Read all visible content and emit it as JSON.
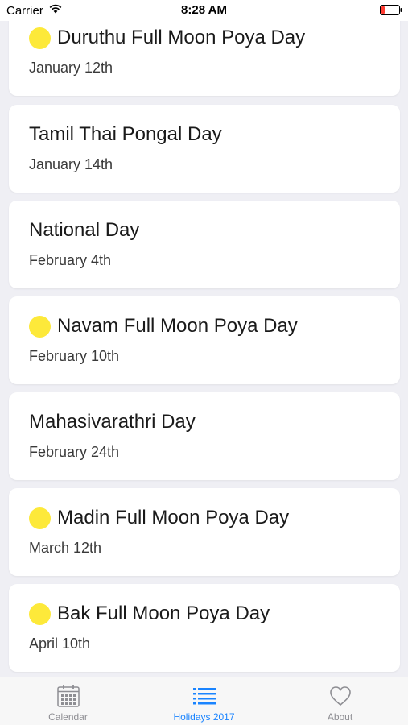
{
  "status_bar": {
    "carrier": "Carrier",
    "time": "8:28 AM",
    "battery_color": "#ff3b30"
  },
  "holidays": [
    {
      "title": "Duruthu Full Moon Poya Day",
      "date": "January 12th",
      "poya": true
    },
    {
      "title": "Tamil Thai Pongal Day",
      "date": "January 14th",
      "poya": false
    },
    {
      "title": "National Day",
      "date": "February 4th",
      "poya": false
    },
    {
      "title": "Navam Full Moon Poya Day",
      "date": "February 10th",
      "poya": true
    },
    {
      "title": "Mahasivarathri Day",
      "date": "February 24th",
      "poya": false
    },
    {
      "title": "Madin Full Moon Poya Day",
      "date": "March 12th",
      "poya": true
    },
    {
      "title": "Bak Full Moon Poya Day",
      "date": "April 10th",
      "poya": true
    }
  ],
  "tab_bar": {
    "tabs": [
      {
        "label": "Calendar",
        "icon": "calendar-icon",
        "active": false
      },
      {
        "label": "Holidays 2017",
        "icon": "list-icon",
        "active": true
      },
      {
        "label": "About",
        "icon": "heart-icon",
        "active": false
      }
    ]
  },
  "colors": {
    "moon": "#fde93a",
    "accent": "#1a84ff",
    "inactive": "#8e8e93",
    "background": "#efeff4"
  }
}
